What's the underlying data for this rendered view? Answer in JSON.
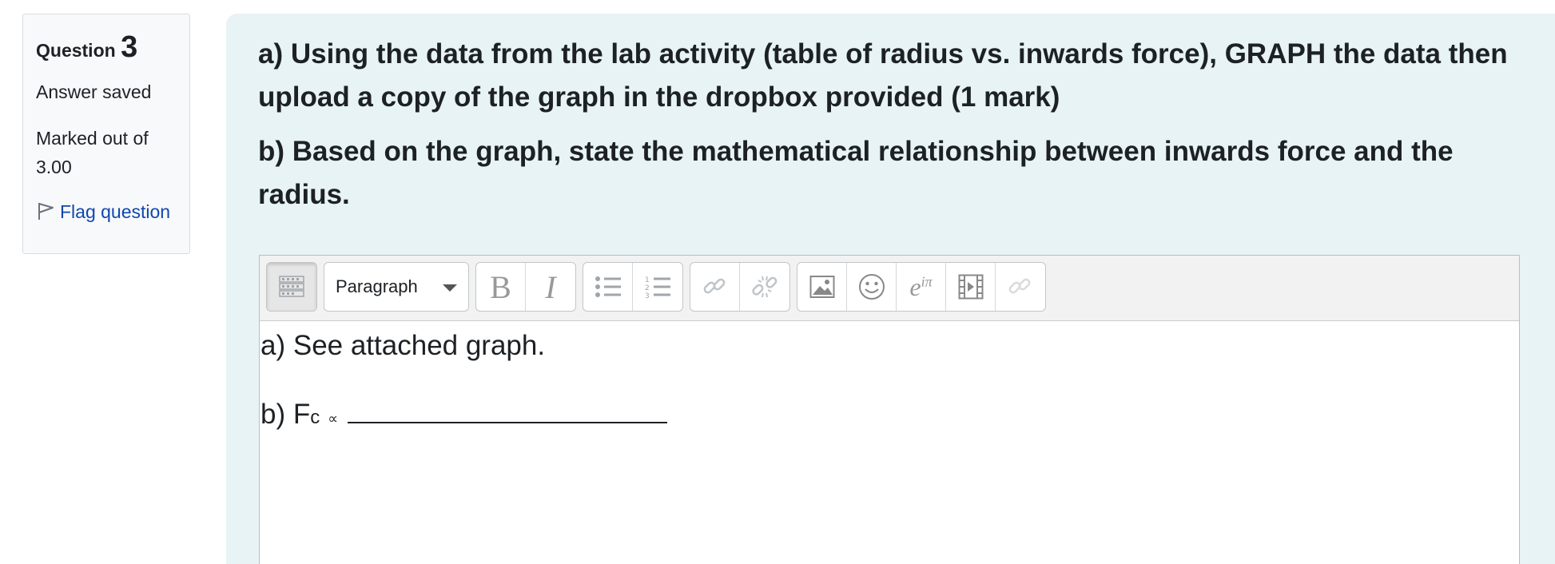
{
  "info": {
    "question_label": "Question",
    "question_number": "3",
    "state": "Answer saved",
    "grade": "Marked out of 3.00",
    "flag_label": "Flag question"
  },
  "question": {
    "part_a": "a)  Using the data from the lab activity (table of radius vs. inwards force), GRAPH the data then upload a copy of the graph in the dropbox provided (1 mark)",
    "part_b": "b)  Based on the graph, state the mathematical relationship between inwards force and the radius."
  },
  "editor": {
    "toolbar": {
      "paragraph_label": "Paragraph",
      "bold_label": "B",
      "italic_label": "I",
      "equation_base": "e",
      "equation_sup": "iπ",
      "icons": [
        "show-more-icon",
        "bulleted-list-icon",
        "numbered-list-icon",
        "link-icon",
        "unlink-icon",
        "image-icon",
        "emoji-icon",
        "equation-icon",
        "media-icon",
        "manage-files-icon"
      ]
    },
    "content": {
      "line_a": "a)  See attached graph.",
      "line_b_prefix": "b)  F",
      "line_b_sub": "c",
      "line_b_symbol": "∝"
    }
  },
  "colors": {
    "content_bg": "#e7f3f5",
    "link": "#0f47ad",
    "text": "#1d2125",
    "icon_disabled": "#9a9fa4"
  }
}
